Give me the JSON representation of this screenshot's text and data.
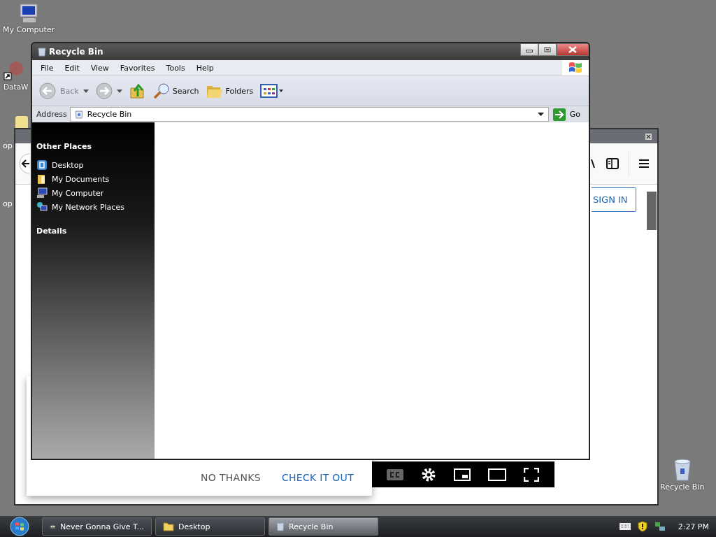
{
  "desktop_icons": [
    {
      "label": "My Computer",
      "kind": "computer"
    },
    {
      "label": "DataW",
      "kind": "shortcut"
    },
    {
      "label": "Recycle Bin",
      "kind": "bin"
    }
  ],
  "hidden_labels": [
    "op",
    "op"
  ],
  "browser": {
    "sign_in": "SIGN IN",
    "dialog_buttons": [
      {
        "label": "NO THANKS",
        "kind": "dismiss"
      },
      {
        "label": "CHECK IT OUT",
        "kind": "accept"
      }
    ]
  },
  "explorer": {
    "title": "Recycle Bin",
    "menu": [
      "File",
      "Edit",
      "View",
      "Favorites",
      "Tools",
      "Help"
    ],
    "toolbar": [
      {
        "kind": "back",
        "label": "Back",
        "disabled": true
      },
      {
        "kind": "forward",
        "disabled": true
      },
      {
        "kind": "up"
      },
      {
        "kind": "search",
        "label": "Search"
      },
      {
        "kind": "folders",
        "label": "Folders"
      },
      {
        "kind": "views"
      }
    ],
    "address_label": "Address",
    "address": "Recycle Bin",
    "go": "Go",
    "sidebar": [
      {
        "title": "Other Places",
        "items": [
          {
            "label": "Desktop",
            "kind": "desktop"
          },
          {
            "label": "My Documents",
            "kind": "documents"
          },
          {
            "label": "My Computer",
            "kind": "computer"
          },
          {
            "label": "My Network Places",
            "kind": "network"
          }
        ]
      },
      {
        "title": "Details"
      }
    ]
  },
  "taskbar": {
    "tasks": [
      {
        "label": "Never Gonna Give T...",
        "kind": "media",
        "selected": false
      },
      {
        "label": "Desktop",
        "kind": "folder",
        "selected": false
      },
      {
        "label": "Recycle Bin",
        "kind": "bin",
        "selected": true
      }
    ],
    "clock": "2:27 PM"
  }
}
